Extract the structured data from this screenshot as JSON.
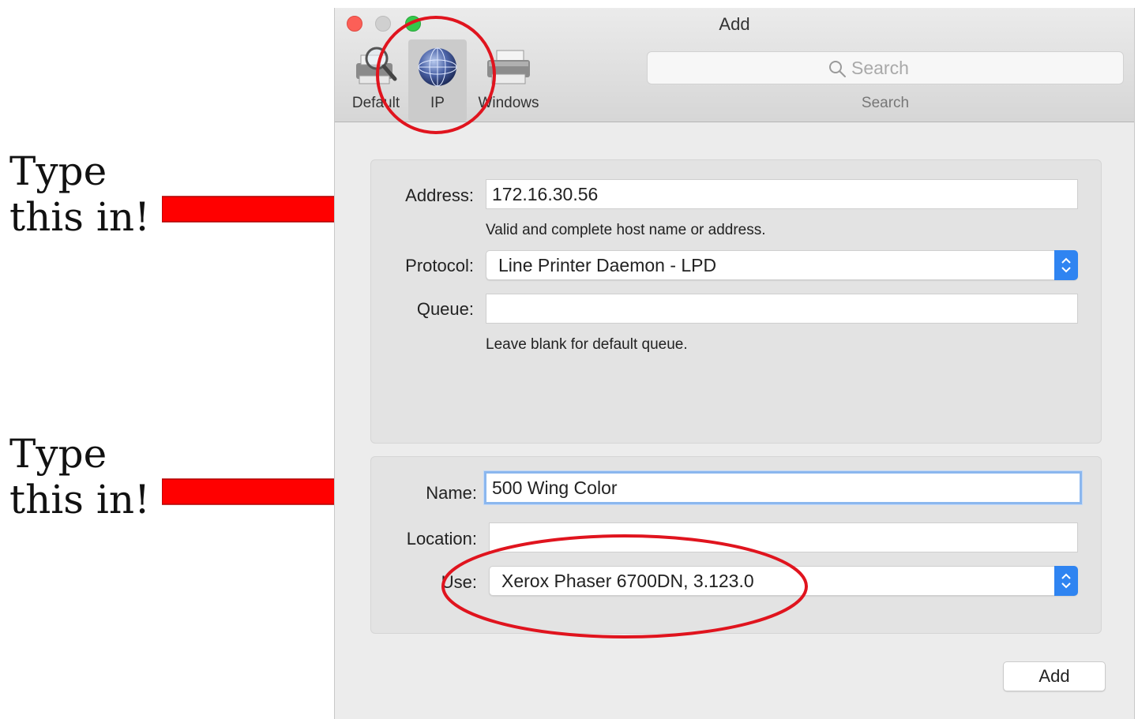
{
  "annotations": {
    "callout_1": [
      "Type",
      "this in!"
    ],
    "callout_2": [
      "Type",
      "this in!"
    ],
    "arrow_color": "#ff0000",
    "circle_color": "#e0141e"
  },
  "window": {
    "title": "Add",
    "toolbar": [
      {
        "label": "Default",
        "icon": "default-printer-icon"
      },
      {
        "label": "IP",
        "icon": "globe-icon",
        "selected": true
      },
      {
        "label": "Windows",
        "icon": "windows-printer-icon"
      }
    ],
    "search": {
      "placeholder": "Search",
      "label": "Search"
    }
  },
  "ip_panel": {
    "address_label": "Address:",
    "address_value": "172.16.30.56",
    "address_hint": "Valid and complete host name or address.",
    "protocol_label": "Protocol:",
    "protocol_value": "Line Printer Daemon - LPD",
    "queue_label": "Queue:",
    "queue_value": "",
    "queue_hint": "Leave blank for default queue."
  },
  "meta_panel": {
    "name_label": "Name:",
    "name_value": "500 Wing Color",
    "location_label": "Location:",
    "location_value": "",
    "use_label": "Use:",
    "use_value": "Xerox Phaser 6700DN, 3.123.0"
  },
  "buttons": {
    "add": "Add"
  },
  "colors": {
    "accent": "#2f84f1",
    "focus_ring": "#8bb7ee"
  }
}
